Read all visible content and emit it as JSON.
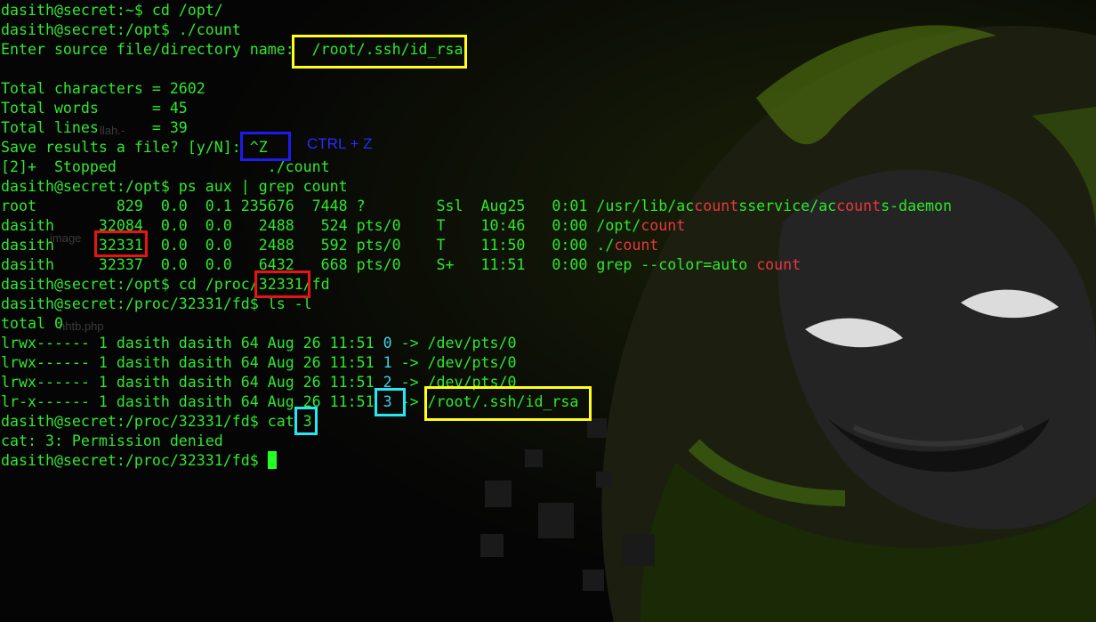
{
  "terminal": {
    "lines": [
      "dasith@secret:~$ cd /opt/",
      "dasith@secret:/opt$ ./count",
      "Enter source file/directory name:  /root/.ssh/id_rsa",
      "",
      "Total characters = 2602",
      "Total words      = 45",
      "Total lines      = 39",
      "Save results a file? [y/N]: ^Z",
      "[2]+  Stopped                 ./count",
      "dasith@secret:/opt$ ps aux | grep count",
      [
        "root         829  0.0  0.1 235676  7448 ?        Ssl  Aug25   0:01 /usr/lib/ac",
        "count",
        "sservice/ac",
        "count",
        "s-daemon"
      ],
      [
        "dasith     32084  0.0  0.0   2488   524 pts/0    T    10:46   0:00 /opt/",
        "count"
      ],
      [
        "dasith     32331  0.0  0.0   2488   592 pts/0    T    11:50   0:00 ./",
        "count"
      ],
      [
        "dasith     32337  0.0  0.0   6432   668 pts/0    S+   11:51   0:00 grep --color=auto ",
        "count"
      ],
      "dasith@secret:/opt$ cd /proc/32331/fd",
      "dasith@secret:/proc/32331/fd$ ls -l",
      "total 0",
      [
        "lrwx------ 1 dasith dasith 64 Aug 26 11:51 ",
        "0",
        " -> /dev/pts/0"
      ],
      [
        "lrwx------ 1 dasith dasith 64 Aug 26 11:51 ",
        "1",
        " -> /dev/pts/0"
      ],
      [
        "lrwx------ 1 dasith dasith 64 Aug 26 11:51 ",
        "2",
        " -> /dev/pts/0"
      ],
      [
        "lr-x------ 1 dasith dasith 64 Aug 26 11:51 ",
        "3",
        " -> /root/.ssh/id_rsa"
      ],
      "dasith@secret:/proc/32331/fd$ cat 3",
      "cat: 3: Permission denied",
      "dasith@secret:/proc/32331/fd$ "
    ]
  },
  "annotations": {
    "ctrl_z_note": "CTRL + Z"
  },
  "desktop_ghosts": {
    "file1": "llah.-",
    "file2": "image",
    "file3": "nhtb.php"
  },
  "colors": {
    "terminal_text": "#2ee82e",
    "grep_match": "#e8383d",
    "fd_number": "#3fd0e8",
    "box_yellow": "#ffff19",
    "box_blue": "#1c1cf0",
    "box_red": "#e81414",
    "box_cyan": "#26e8f0",
    "wallpaper_accent": "#8fd400"
  }
}
